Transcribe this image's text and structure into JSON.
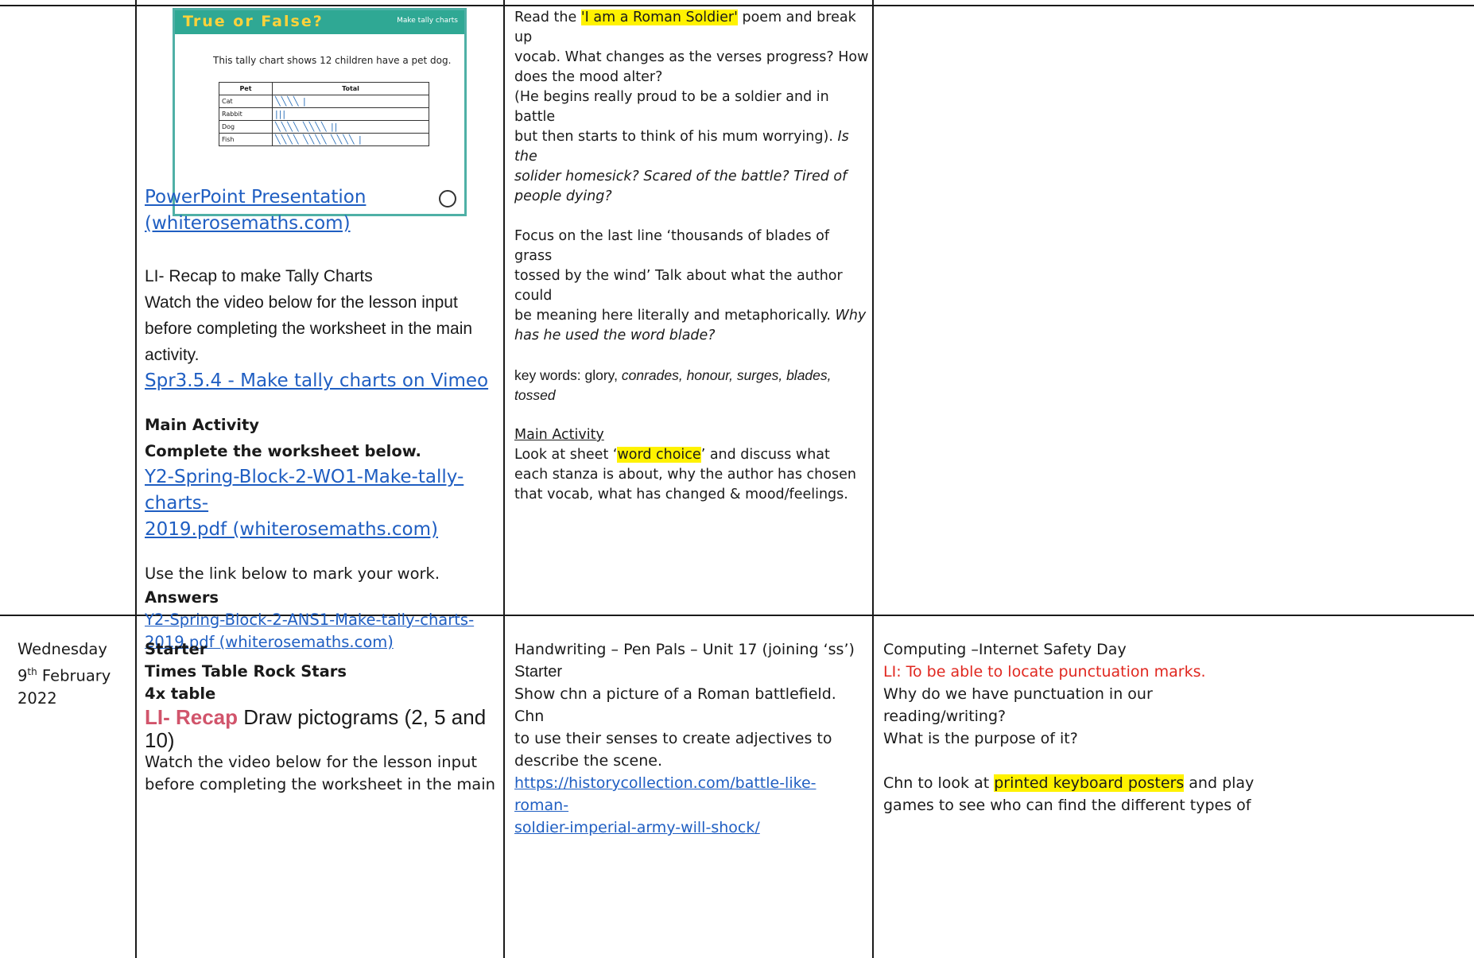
{
  "table_lines": {
    "note": ""
  },
  "col2_top": {
    "thumbnail": {
      "title": "True or False?",
      "subtitle": "Make tally charts",
      "question": "This tally chart shows 12 children have a pet dog.",
      "headers": [
        "Pet",
        "Total"
      ],
      "rows": [
        {
          "pet": "Cat",
          "tally": "╲╲╲╲ |"
        },
        {
          "pet": "Rabbit",
          "tally": "|||"
        },
        {
          "pet": "Dog",
          "tally": "╲╲╲╲ ╲╲╲╲ ||"
        },
        {
          "pet": "Fish",
          "tally": "╲╲╲╲ ╲╲╲╲ ╲╲╲╲ |"
        }
      ]
    },
    "ppt_link_1": "PowerPoint Presentation",
    "ppt_link_2": "(whiterosemaths.com)",
    "li": "LI- Recap to make Tally Charts",
    "watch_1": "Watch the video below for the lesson input",
    "watch_2": "before completing the worksheet in the main",
    "watch_3": "activity.",
    "vimeo_link": "Spr3.5.4 - Make tally charts on Vimeo",
    "main_activity": "Main Activity",
    "complete": "Complete the worksheet below.",
    "worksheet_1": "Y2-Spring-Block-2-WO1-Make-tally-charts-",
    "worksheet_2": "2019.pdf (whiterosemaths.com)",
    "mark": "Use the link below to mark your work.",
    "answers": "Answers",
    "answers_1": "Y2-Spring-Block-2-ANS1-Make-tally-charts-",
    "answers_2": "2019.pdf (whiterosemaths.com)"
  },
  "col3_top": {
    "l1a": "Read the ",
    "l1hl": "'I am a Roman Soldier'",
    "l1b": " poem and break up",
    "l2": "vocab. What changes as the verses progress? How",
    "l3": "does the mood alter?",
    "l4": "(He begins really proud to be a soldier and in battle",
    "l5a": "but then starts to think of his mum worrying). ",
    "l5b": "Is the",
    "l6": "solider homesick? Scared of the battle? Tired of",
    "l7": "people dying?",
    "l8": "Focus on the last line ‘thousands of blades of grass",
    "l9": "tossed by the wind’ Talk about what the author could",
    "l10a": "be meaning here literally and metaphorically. ",
    "l10b": "Why",
    "l11": "has he used the word blade?",
    "kw_a": "key words: glory, ",
    "kw_b": "conrades, honour, surges, blades,",
    "kw_c": "tossed",
    "main_activity": "Main Activity",
    "m1a": "Look at sheet ‘",
    "m1hl": "word choice",
    "m1b": "’ and discuss what",
    "m2": "each stanza is about, why the author has chosen",
    "m3": "that vocab, what has changed & mood/feelings."
  },
  "row2": {
    "day": "Wednesday",
    "date_num": "9",
    "date_sup": "th",
    "date_month": " February",
    "year": "2022",
    "starter": "Starter",
    "ttrs": "Times Table Rock Stars",
    "table": "4x table",
    "li_recap": "LI- Recap",
    "li_rest": " Draw pictograms (2, 5 and",
    "li_rest2": "10)",
    "watch_1": "Watch the video below for the lesson input",
    "watch_2": "before completing the worksheet in the main",
    "hw": "Handwriting – Pen Pals – Unit 17 (joining ‘ss’)",
    "starter2": "Starter",
    "s1": "Show chn a picture of a Roman battlefield. Chn",
    "s2": "to use their senses to create adjectives to",
    "s3": "describe the scene.",
    "url1": "https://historycollection.com/battle-like-roman-",
    "url2": "soldier-imperial-army-will-shock/",
    "comp": "Computing –Internet Safety Day",
    "comp_li": "LI: To be able to locate punctuation marks.",
    "c1": "Why do we have punctuation in our",
    "c2": "reading/writing?",
    "c3": "What is the purpose of it?",
    "c4a": "Chn to look at ",
    "c4hl": "printed keyboard posters",
    "c4b": " and play",
    "c5": "games to see who can find the different types of"
  }
}
